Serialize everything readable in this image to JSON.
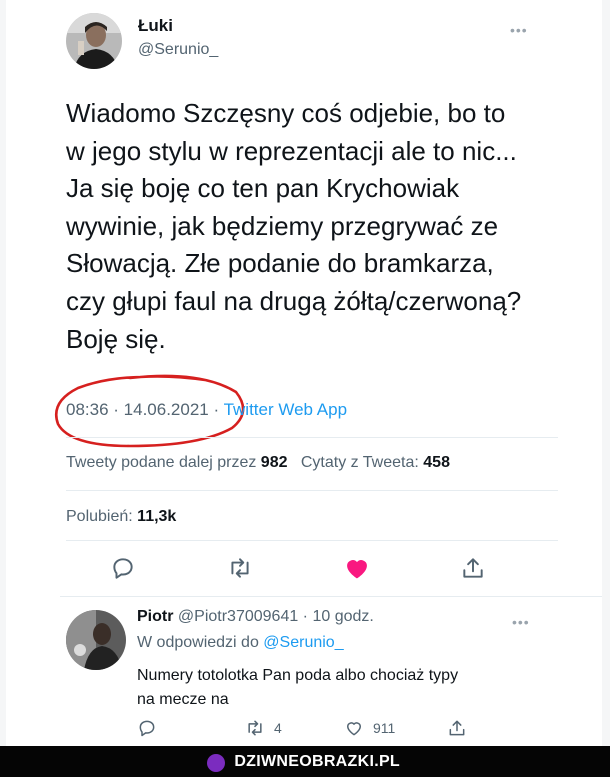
{
  "tweet": {
    "author_name": "Łuki",
    "author_handle": "@Serunio_",
    "more": "•••",
    "text_lines": [
      "Wiadomo Szczęsny coś odjebie, bo to",
      "w jego stylu w reprezentacji ale to nic...",
      "Ja się boję co ten pan Krychowiak",
      "wywinie, jak będziemy przegrywać ze",
      "Słowacją. Złe podanie do bramkarza,",
      "czy głupi faul na drugą żółtą/czerwoną?",
      "Boję się."
    ],
    "time": "08:36",
    "separator": " · ",
    "date": "14.06.2021",
    "source": "Twitter Web App",
    "retweets_label": "Tweety podane dalej przez",
    "retweets_count": "982",
    "quotes_label": "Cytaty z Tweeta:",
    "quotes_count": "458",
    "likes_label": "Polubień:",
    "likes_count": "11,3k",
    "annotation_color": "#d6201f",
    "like_color": "#f91880"
  },
  "reply": {
    "name": "Piotr",
    "handle": "@Piotr37009641",
    "time_sep": " · ",
    "time": "10 godz.",
    "more": "•••",
    "reply_to_prefix": "W odpowiedzi do",
    "reply_to_handle": "@Serunio_",
    "text_lines": [
      "Numery totolotka Pan poda albo chociaż typy",
      "na mecze na"
    ],
    "retweets": "4",
    "likes": "911"
  },
  "banner": {
    "label": "DZIWNEOBRAZKI.PL"
  },
  "colors": {
    "accent": "#1d9bf0",
    "muted": "#536471",
    "text": "#0f1419"
  }
}
